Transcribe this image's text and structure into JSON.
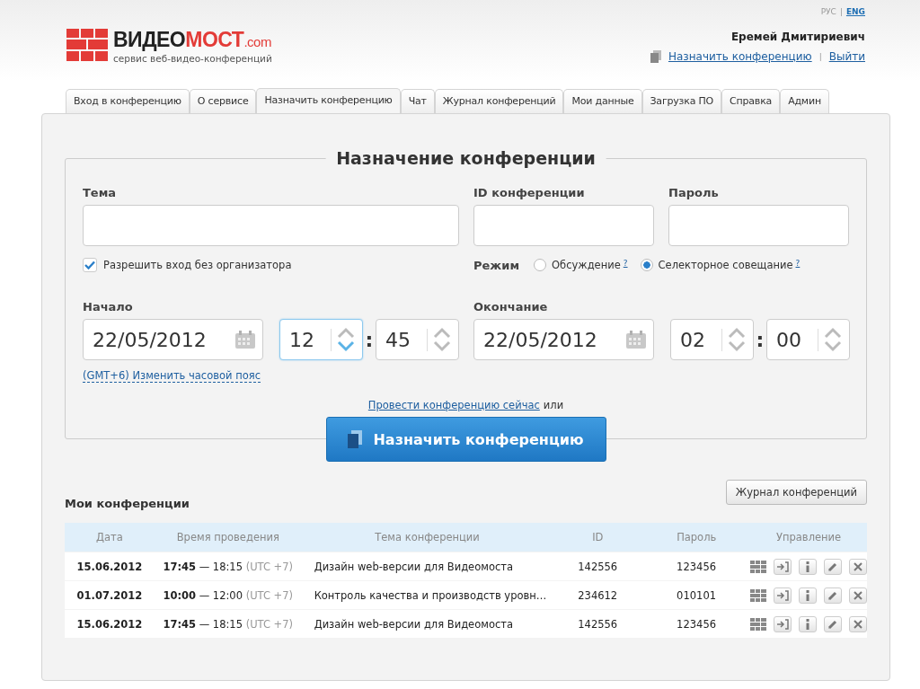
{
  "header": {
    "logo": {
      "word": "ВИДЕО",
      "accent": "МОСТ",
      "domain": ".com",
      "tagline": "сервис веб-видео-конференций"
    },
    "languages": [
      {
        "label": "РУС",
        "selected": false
      },
      {
        "label": "ENG",
        "selected": true
      }
    ],
    "language_separator": "|",
    "link_separator": "|",
    "user_name": "Еремей Дмитириевич",
    "schedule_link": "Назначить конференцию",
    "logout_link": "Выйти"
  },
  "tabs": [
    {
      "label": "Вход в конференцию",
      "selected": false
    },
    {
      "label": "О сервисе",
      "selected": false
    },
    {
      "label": "Назначить конференцию",
      "selected": true
    },
    {
      "label": "Чат",
      "selected": false
    },
    {
      "label": "Журнал конференций",
      "selected": false
    },
    {
      "label": "Мои данные",
      "selected": false
    },
    {
      "label": "Загрузка ПО",
      "selected": false
    },
    {
      "label": "Справка",
      "selected": false
    },
    {
      "label": "Админ",
      "selected": false
    }
  ],
  "form": {
    "title": "Назначение конференции",
    "topic": {
      "label": "Тема"
    },
    "conference_id": {
      "label": "ID конференции"
    },
    "password": {
      "label": "Пароль"
    },
    "allow_without_organizer": {
      "label": "Разрешить вход без организатора",
      "checked": true
    },
    "mode": {
      "label": "Режим",
      "options": [
        {
          "label": "Обсуждение",
          "help": "?",
          "selected": false
        },
        {
          "label": "Селекторное совещание",
          "help": "?",
          "selected": true
        }
      ]
    },
    "start": {
      "label": "Начало",
      "date": "22/05/2012",
      "hour": "12",
      "minute": "45",
      "separator": ":",
      "hour_focused": true
    },
    "end": {
      "label": "Окончание",
      "date": "22/05/2012",
      "hour": "02",
      "minute": "00",
      "separator": ":",
      "hour_focused": false
    },
    "timezone_link": "(GMT+6) Изменить часовой пояс",
    "now_link": "Провести конференцию сейчас",
    "now_suffix": "или",
    "submit": "Назначить конференцию"
  },
  "my_conferences": {
    "title": "Мои конференции",
    "journal_button": "Журнал конференций",
    "columns": [
      "Дата",
      "Время проведения",
      "Тема конференции",
      "ID",
      "Пароль",
      "Управление"
    ],
    "rows": [
      {
        "date": "15.06.2012",
        "time": "**17:45** — 18:15",
        "tz": "(UTC +7)",
        "topic": "Дизайн web-версии для Видеомоста",
        "id": "142556",
        "password": "123456"
      },
      {
        "date": "01.07.2012",
        "time": "**10:00** — 12:00",
        "tz": "(UTC +7)",
        "topic": "Контроль качества и производств уровн…",
        "id": "234612",
        "password": "010101"
      },
      {
        "date": "15.06.2012",
        "time": "**17:45** — 18:15",
        "tz": "(UTC +7)",
        "topic": "Дизайн web-версии для Видеомоста",
        "id": "142556",
        "password": "123456"
      }
    ]
  }
}
